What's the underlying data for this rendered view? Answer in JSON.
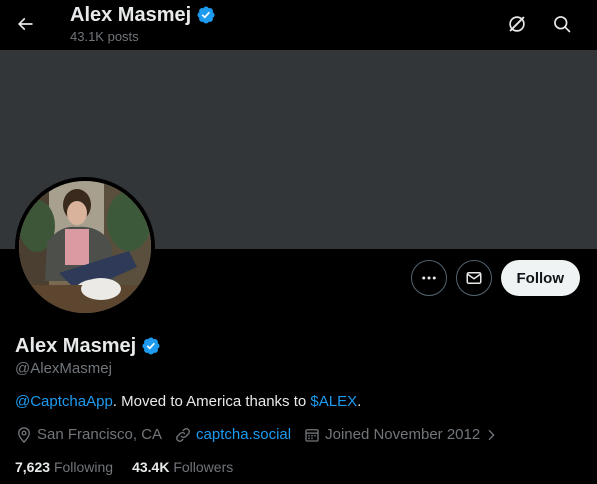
{
  "header": {
    "name": "Alex Masmej",
    "posts": "43.1K posts"
  },
  "profile": {
    "name": "Alex Masmej",
    "handle": "@AlexMasmej",
    "bio_mention": "@CaptchaApp",
    "bio_middle": ". Moved to America thanks to ",
    "bio_cashtag": "$ALEX",
    "bio_end": ".",
    "location": "San Francisco, CA",
    "website": "captcha.social",
    "joined": "Joined November 2012",
    "following_count": "7,623",
    "following_label": "Following",
    "followers_count": "43.4K",
    "followers_label": "Followers"
  },
  "actions": {
    "follow_label": "Follow"
  },
  "colors": {
    "accent": "#1d9bf0",
    "background": "#000000",
    "banner": "#333639",
    "text_secondary": "#71767b"
  },
  "icons": {
    "back": "arrow-left-icon",
    "grok": "grok-icon",
    "search": "search-icon",
    "more": "more-icon",
    "message": "mail-icon",
    "verified": "verified-badge-icon",
    "location": "location-pin-icon",
    "link": "link-icon",
    "calendar": "calendar-icon",
    "chevron": "chevron-right-icon"
  }
}
